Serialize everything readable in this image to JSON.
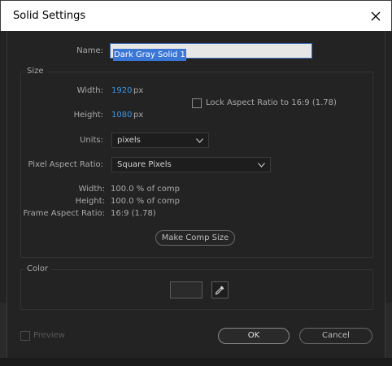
{
  "window": {
    "title": "Solid Settings"
  },
  "name": {
    "label": "Name:",
    "value": "Dark Gray Solid 1"
  },
  "size": {
    "group_title": "Size",
    "width_label": "Width:",
    "width_value": "1920",
    "width_unit": "px",
    "height_label": "Height:",
    "height_value": "1080",
    "height_unit": "px",
    "lock_label": "Lock Aspect Ratio to 16:9 (1.78)",
    "lock_checked": false,
    "units_label": "Units:",
    "units_value": "pixels",
    "par_label": "Pixel Aspect Ratio:",
    "par_value": "Square Pixels",
    "info": {
      "width_label": "Width:",
      "width_value": "100.0 % of comp",
      "height_label": "Height:",
      "height_value": "100.0 % of comp",
      "far_label": "Frame Aspect Ratio:",
      "far_value": "16:9 (1.78)"
    },
    "make_comp_size_label": "Make Comp Size"
  },
  "color": {
    "group_title": "Color",
    "swatch_hex": "#2b2b2b"
  },
  "footer": {
    "preview_label": "Preview",
    "ok_label": "OK",
    "cancel_label": "Cancel"
  },
  "icons": {
    "close": "close-icon",
    "chevron": "chevron-down-icon",
    "eyedropper": "eyedropper-icon"
  }
}
